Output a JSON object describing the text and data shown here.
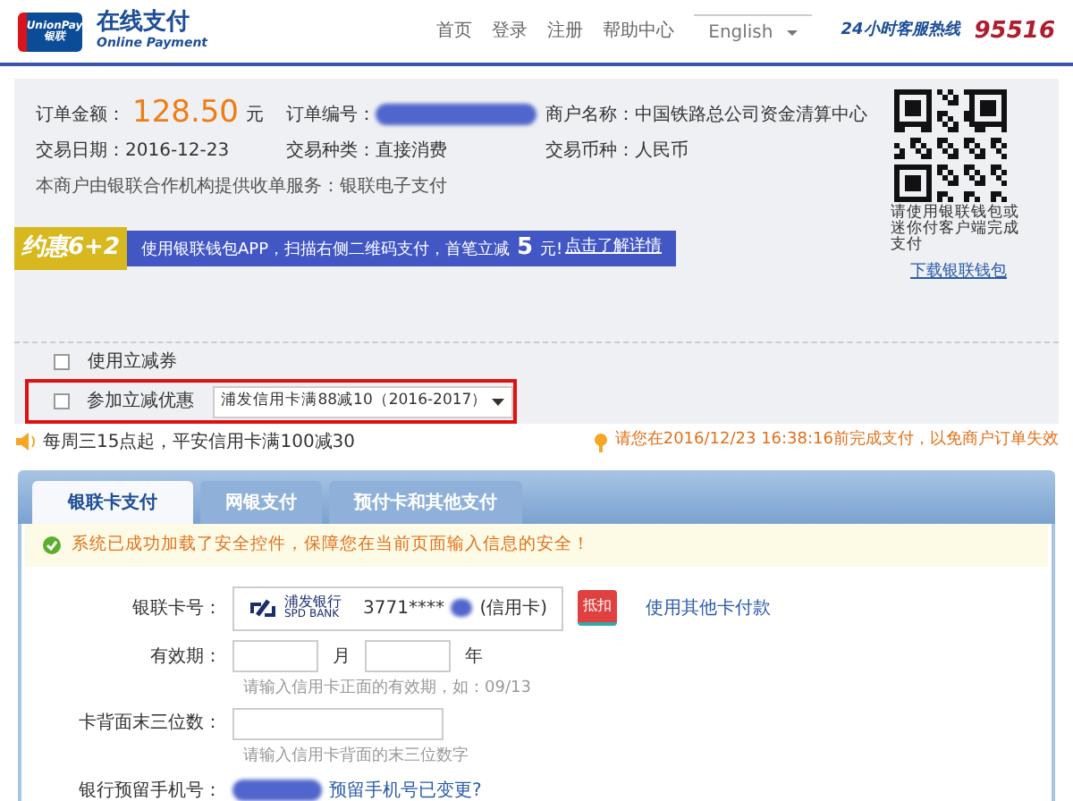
{
  "header": {
    "logo_top": "UnionPay",
    "logo_bottom": "银联",
    "brand_title": "在线支付",
    "brand_subtitle": "Online Payment",
    "nav": [
      "首页",
      "登录",
      "注册",
      "帮助中心"
    ],
    "language": "English",
    "hotline_label": "24小时客服热线",
    "hotline_number": "95516"
  },
  "order": {
    "amount_label": "订单金额：",
    "amount": "128.50",
    "currency_unit": "元",
    "number_label": "订单编号：",
    "merchant_label": "商户名称：",
    "merchant": "中国铁路总公司资金清算中心",
    "date_label": "交易日期：",
    "date": "2016-12-23",
    "type_label": "交易种类：",
    "type": "直接消费",
    "currency_label": "交易币种：",
    "currency": "人民币",
    "service_note": "本商户由银联合作机构提供收单服务：银联电子支付"
  },
  "qr": {
    "caption": "请使用银联钱包或迷你付客户端完成支付",
    "download_link": "下载银联钱包"
  },
  "promo": {
    "badge": "约惠6+2",
    "text": "使用银联钱包APP，扫描右侧二维码支付，首笔立减",
    "amount": "5",
    "unit": "元!",
    "link": "点击了解详情"
  },
  "discounts": [
    {
      "label": "使用立减券",
      "checked": false,
      "highlighted": false
    },
    {
      "label": "参加立减优惠",
      "checked": false,
      "highlighted": true,
      "select_value": "浦发信用卡满88减10（2016-2017）"
    }
  ],
  "notice": "每周三15点起，平安信用卡满100减30",
  "deadline": "请您在2016/12/23 16:38:16前完成支付，以免商户订单失效",
  "tabs": [
    {
      "label": "银联卡支付",
      "selected": true
    },
    {
      "label": "网银支付",
      "selected": false
    },
    {
      "label": "预付卡和其他支付",
      "selected": false
    }
  ],
  "security_message": "系统已成功加载了安全控件，保障您在当前页面输入信息的安全！",
  "form": {
    "card_label": "银联卡号：",
    "bank_name": "浦发银行",
    "bank_name_en": "SPD BANK",
    "card_number": "3771****",
    "card_type": "(信用卡)",
    "deduct_tag": "抵扣",
    "other_card_link": "使用其他卡付款",
    "expiry_label": "有效期：",
    "month_unit": "月",
    "year_unit": "年",
    "expiry_hint": "请输入信用卡正面的有效期，如：09/13",
    "cvv_label": "卡背面末三位数：",
    "cvv_hint": "请输入信用卡背面的末三位数字",
    "phone_label": "银行预留手机号：",
    "phone_changed_link": "预留手机号已变更?"
  }
}
